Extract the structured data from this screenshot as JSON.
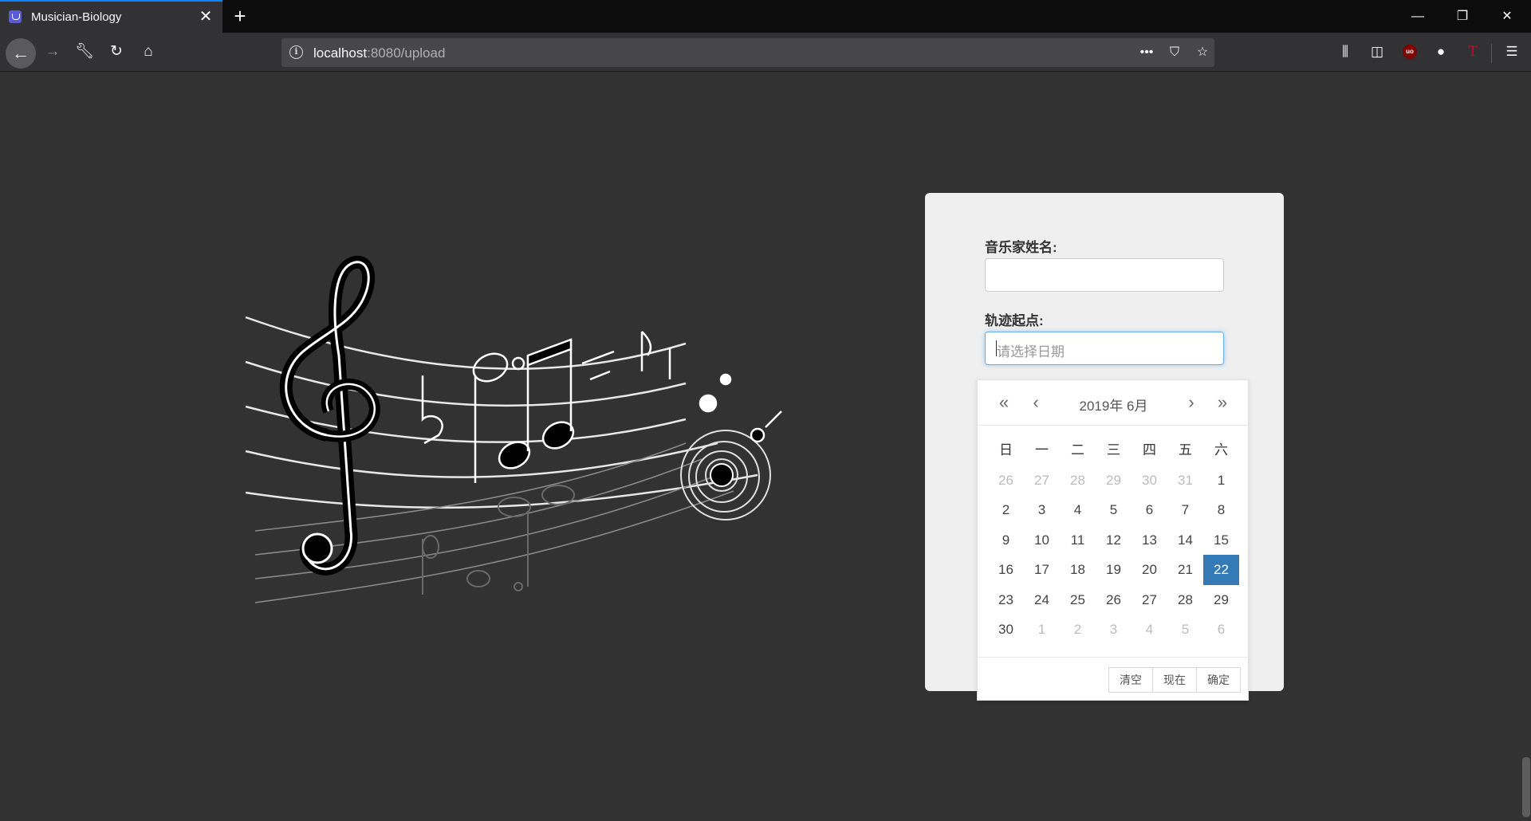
{
  "browser": {
    "tab_title": "Musician-Biology",
    "url_host": "localhost",
    "url_path": ":8080/upload"
  },
  "form": {
    "name_label": "音乐家姓名:",
    "name_value": "",
    "track_label": "轨迹起点:",
    "date_placeholder": "请选择日期"
  },
  "datepicker": {
    "title": "2019年  6月",
    "weekdays": [
      "日",
      "一",
      "二",
      "三",
      "四",
      "五",
      "六"
    ],
    "weeks": [
      [
        "26",
        "27",
        "28",
        "29",
        "30",
        "31",
        "1"
      ],
      [
        "2",
        "3",
        "4",
        "5",
        "6",
        "7",
        "8"
      ],
      [
        "9",
        "10",
        "11",
        "12",
        "13",
        "14",
        "15"
      ],
      [
        "16",
        "17",
        "18",
        "19",
        "20",
        "21",
        "22"
      ],
      [
        "23",
        "24",
        "25",
        "26",
        "27",
        "28",
        "29"
      ],
      [
        "30",
        "1",
        "2",
        "3",
        "4",
        "5",
        "6"
      ]
    ],
    "selected": "22",
    "buttons": {
      "clear": "清空",
      "now": "现在",
      "confirm": "确定"
    },
    "selected_color": "#337ab7"
  },
  "icons": [
    "back-icon",
    "forward-icon",
    "wrench-icon",
    "reload-icon",
    "home-icon",
    "info-icon",
    "more-icon",
    "pocket-icon",
    "bookmark-star-icon",
    "library-icon",
    "sidebar-icon",
    "ublock-icon",
    "account-icon",
    "t-extension-icon",
    "menu-icon",
    "treble-clef-icon"
  ]
}
